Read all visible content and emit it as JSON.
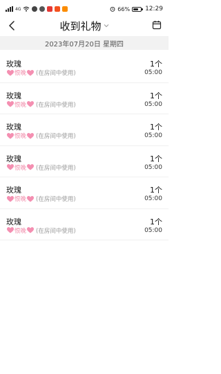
{
  "status_bar": {
    "network_label": "4G",
    "battery": "66%",
    "battery_level": 0.66,
    "time": "12:29"
  },
  "header": {
    "title": "收到礼物"
  },
  "date_label": "2023年07月20日 星期四",
  "gifts": [
    {
      "name": "玫瑰",
      "sender": "恨晚",
      "location": "(在房间中使用)",
      "quantity": "1个",
      "time": "05:00"
    },
    {
      "name": "玫瑰",
      "sender": "恨晚",
      "location": "(在房间中使用)",
      "quantity": "1个",
      "time": "05:00"
    },
    {
      "name": "玫瑰",
      "sender": "恨晚",
      "location": "(在房间中使用)",
      "quantity": "1个",
      "time": "05:00"
    },
    {
      "name": "玫瑰",
      "sender": "恨晚",
      "location": "(在房间中使用)",
      "quantity": "1个",
      "time": "05:00"
    },
    {
      "name": "玫瑰",
      "sender": "恨晚",
      "location": "(在房间中使用)",
      "quantity": "1个",
      "time": "05:00"
    },
    {
      "name": "玫瑰",
      "sender": "恨晚",
      "location": "(在房间中使用)",
      "quantity": "1个",
      "time": "05:00"
    }
  ],
  "colors": {
    "heart": "#f48fb1",
    "date_bar_bg": "#f2f2f2"
  }
}
